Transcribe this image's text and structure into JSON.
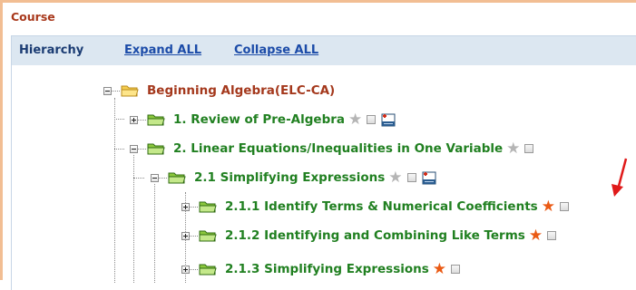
{
  "section": {
    "title": "Course"
  },
  "toolbar": {
    "hierarchy_label": "Hierarchy",
    "expand_label": "Expand ALL",
    "collapse_label": "Collapse ALL"
  },
  "tree": {
    "root": {
      "label": "Beginning Algebra(ELC-CA)",
      "expanded": true
    },
    "nodes": [
      {
        "label": "1. Review of Pre-Algebra",
        "expanded": false,
        "star": "grey",
        "has_add_icon": true
      },
      {
        "label": "2. Linear Equations/Inequalities in One Variable",
        "expanded": true,
        "star": "grey",
        "has_add_icon": false
      },
      {
        "label": "2.1 Simplifying Expressions",
        "expanded": true,
        "star": "grey",
        "has_add_icon": true
      },
      {
        "label": "2.1.1 Identify Terms & Numerical Coefficients",
        "expanded": false,
        "star": "orange",
        "has_add_icon": false
      },
      {
        "label": "2.1.2 Identifying and Combining Like Terms",
        "expanded": false,
        "star": "orange",
        "has_add_icon": false
      },
      {
        "label": "2.1.3 Simplifying Expressions",
        "expanded": false,
        "star": "orange",
        "has_add_icon": false
      }
    ]
  },
  "icons": {
    "star": "★",
    "folder": "folder-icon",
    "add": "add-subtopic-icon",
    "arrow": "red-pointer-arrow"
  },
  "colors": {
    "border": "#f2be93",
    "toolbar_bg": "#dce7f1",
    "root_text": "#a4381c",
    "node_text": "#218021",
    "star_active": "#ea5a14",
    "star_inactive": "#b5b5b5"
  }
}
